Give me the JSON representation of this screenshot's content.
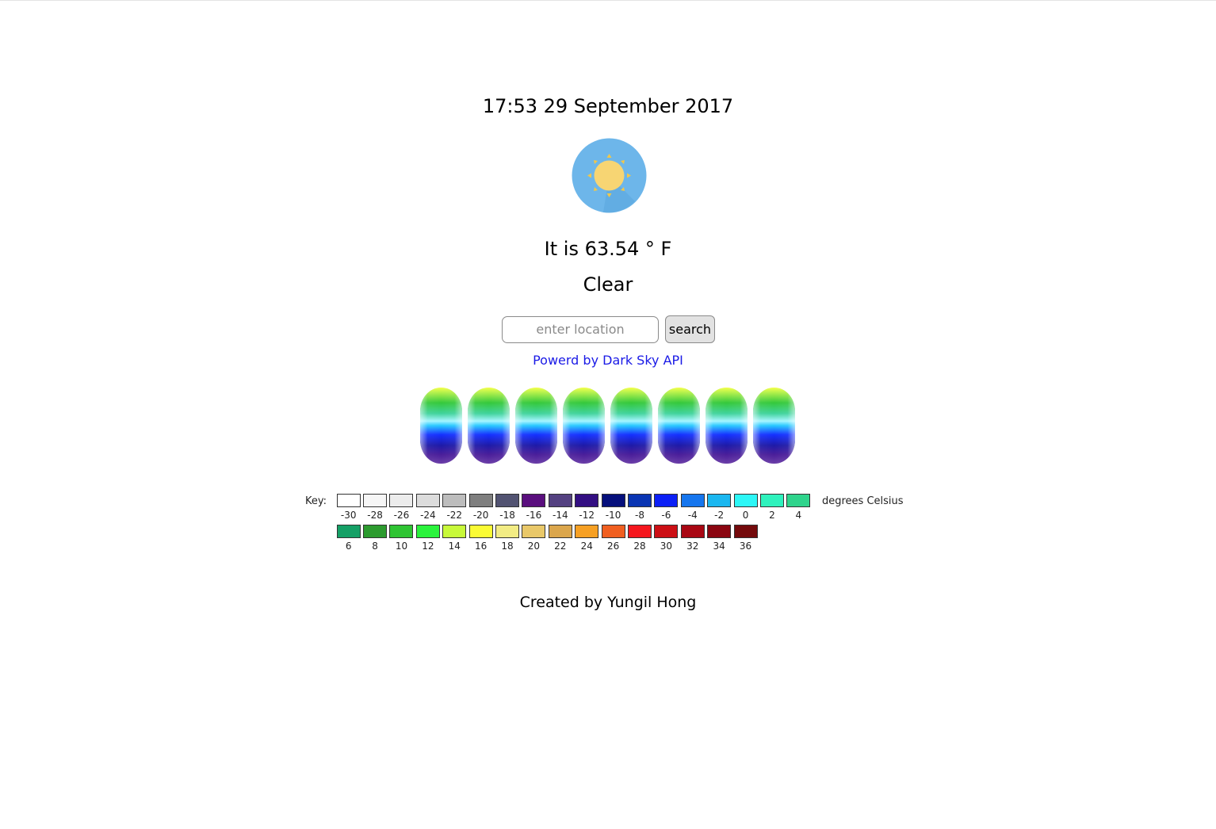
{
  "weather": {
    "datetime": "17:53 29 September 2017",
    "icon": "clear-day-sun-icon",
    "temperature_text": "It is 63.54 ° F",
    "summary": "Clear"
  },
  "search": {
    "placeholder": "enter location",
    "button_label": "search"
  },
  "powered_by": {
    "label": "Powerd by Dark Sky API",
    "link_color": "#1a1ae6"
  },
  "forecast_bars": {
    "count": 8
  },
  "legend": {
    "key_label": "Key:",
    "unit_label": "degrees Celsius",
    "rows": [
      [
        {
          "value": "-30",
          "color": "#ffffff"
        },
        {
          "value": "-28",
          "color": "#f6f6f6"
        },
        {
          "value": "-26",
          "color": "#ececec"
        },
        {
          "value": "-24",
          "color": "#dcdcdc"
        },
        {
          "value": "-22",
          "color": "#bdbdbd"
        },
        {
          "value": "-20",
          "color": "#7f7f7f"
        },
        {
          "value": "-18",
          "color": "#525372"
        },
        {
          "value": "-16",
          "color": "#5a0f7e"
        },
        {
          "value": "-14",
          "color": "#544181"
        },
        {
          "value": "-12",
          "color": "#330f82"
        },
        {
          "value": "-10",
          "color": "#06107c"
        },
        {
          "value": "-8",
          "color": "#0a35b3"
        },
        {
          "value": "-6",
          "color": "#0c20f6"
        },
        {
          "value": "-4",
          "color": "#1676ee"
        },
        {
          "value": "-2",
          "color": "#1bb7f0"
        },
        {
          "value": "0",
          "color": "#2df7f7"
        },
        {
          "value": "2",
          "color": "#2ff2bd"
        },
        {
          "value": "4",
          "color": "#2fd48c"
        }
      ],
      [
        {
          "value": "6",
          "color": "#15a066"
        },
        {
          "value": "8",
          "color": "#2d9b2f"
        },
        {
          "value": "10",
          "color": "#2fc433"
        },
        {
          "value": "12",
          "color": "#2af33c"
        },
        {
          "value": "14",
          "color": "#c8f93a"
        },
        {
          "value": "16",
          "color": "#fafb34"
        },
        {
          "value": "18",
          "color": "#f2ec84"
        },
        {
          "value": "20",
          "color": "#e9c869"
        },
        {
          "value": "22",
          "color": "#dba64c"
        },
        {
          "value": "24",
          "color": "#f6a024"
        },
        {
          "value": "26",
          "color": "#f05f20"
        },
        {
          "value": "28",
          "color": "#f5171e"
        },
        {
          "value": "30",
          "color": "#cc0f15"
        },
        {
          "value": "32",
          "color": "#a90713"
        },
        {
          "value": "34",
          "color": "#8b0611"
        },
        {
          "value": "36",
          "color": "#740a0c"
        }
      ]
    ]
  },
  "footer": {
    "credit": "Created by Yungil Hong"
  }
}
